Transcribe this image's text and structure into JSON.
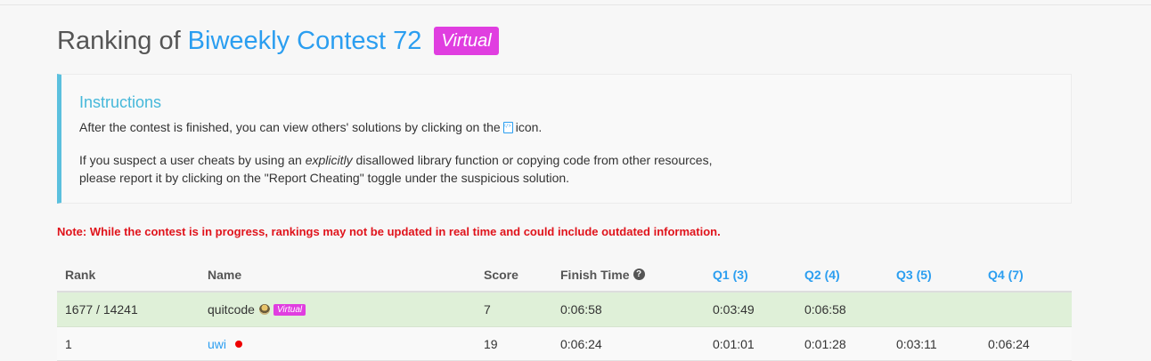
{
  "title": {
    "prefix": "Ranking of",
    "contest": "Biweekly Contest 72",
    "badge": "Virtual"
  },
  "instructions": {
    "title": "Instructions",
    "p1_before": "After the contest is finished, you can view others' solutions by clicking on the",
    "p1_icon": "code-icon",
    "p1_after": "icon.",
    "p2_before": "If you suspect a user cheats by using an ",
    "p2_em": "explicitly",
    "p2_after": " disallowed library function or copying code from other resources,",
    "p2_line2": "please report it by clicking on the \"Report Cheating\" toggle under the suspicious solution."
  },
  "note": "Note: While the contest is in progress, rankings may not be updated in real time and could include outdated information.",
  "table": {
    "headers": {
      "rank": "Rank",
      "name": "Name",
      "score": "Score",
      "finish_time": "Finish Time",
      "q1": "Q1 (3)",
      "q2": "Q2 (4)",
      "q3": "Q3 (5)",
      "q4": "Q4 (7)"
    },
    "rows": [
      {
        "rank": "1677 / 14241",
        "name": "quitcode",
        "badge": "Virtual",
        "score": "7",
        "finish_time": "0:06:58",
        "q1": "0:03:49",
        "q2": "0:06:58",
        "q3": "",
        "q4": ""
      },
      {
        "rank": "1",
        "name": "uwi",
        "score": "19",
        "finish_time": "0:06:24",
        "q1": "0:01:01",
        "q2": "0:01:28",
        "q3": "0:03:11",
        "q4": "0:06:24"
      }
    ]
  },
  "colors": {
    "accent_blue": "#2b9ef0",
    "virtual_badge": "#e03ee0",
    "note_red": "#e0131b",
    "highlight_row": "#dff0d8"
  }
}
